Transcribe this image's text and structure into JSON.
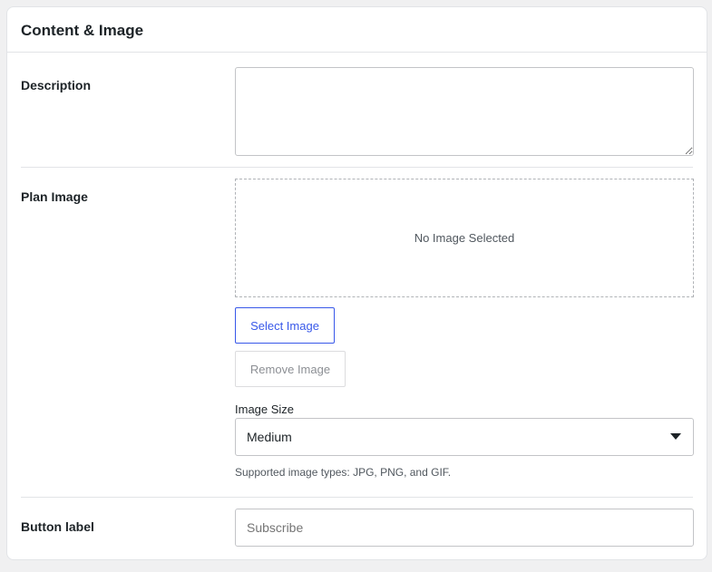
{
  "panel": {
    "title": "Content & Image"
  },
  "description": {
    "label": "Description",
    "value": ""
  },
  "plan_image": {
    "label": "Plan Image",
    "empty_text": "No Image Selected",
    "select_button": "Select Image",
    "remove_button": "Remove Image",
    "size_label": "Image Size",
    "size_value": "Medium",
    "help_text": "Supported image types: JPG, PNG, and GIF."
  },
  "button_label": {
    "label": "Button label",
    "placeholder": "Subscribe",
    "value": ""
  },
  "icons": {
    "select_arrow": "chevron-down-icon"
  }
}
